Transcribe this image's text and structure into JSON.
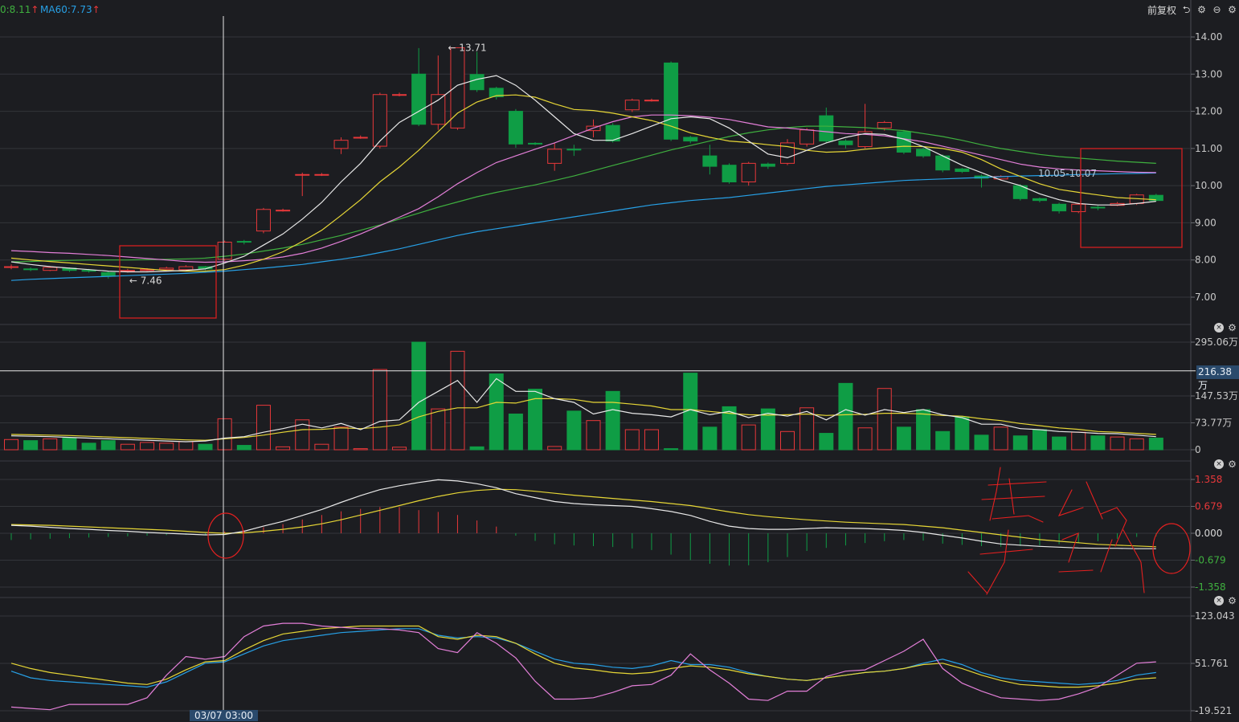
{
  "header": {
    "ma_left": "0:8.11",
    "ma_left_arrow": "↑",
    "ma60": "MA60:7.73",
    "ma60_arrow": "↑",
    "fq_label": "前复权"
  },
  "colors": {
    "bg": "#1c1d21",
    "grid": "#33353a",
    "up": "#e8383a",
    "down": "#0f9d45",
    "ma5": "#e8e8e8",
    "ma10": "#e6d636",
    "ma20": "#e37fd8",
    "ma30": "#3fb03f",
    "ma60": "#27a0e6",
    "highlight": "#d42020",
    "annot": "#e52020"
  },
  "crosshair": {
    "time_label": "03/07 03:00",
    "volume_value": "216.38万"
  },
  "chart_data": [
    {
      "type": "candlestick",
      "panel": "price",
      "ylim": [
        7.0,
        14.0
      ],
      "y_ticks": [
        "14.00",
        "13.00",
        "12.00",
        "11.00",
        "10.00",
        "9.00",
        "8.00",
        "7.00"
      ],
      "y_tick_values": [
        14,
        13,
        12,
        11,
        10,
        9,
        8,
        7
      ],
      "annotations": {
        "high_label": "13.71",
        "low_label": "7.46",
        "range_label": "10.05-10.07"
      },
      "candles": [
        [
          7.8,
          7.82,
          7.75,
          7.88
        ],
        [
          7.76,
          7.74,
          7.7,
          7.8
        ],
        [
          7.72,
          7.8,
          7.7,
          7.84
        ],
        [
          7.78,
          7.72,
          7.68,
          7.8
        ],
        [
          7.72,
          7.7,
          7.66,
          7.76
        ],
        [
          7.66,
          7.56,
          7.5,
          7.7
        ],
        [
          7.7,
          7.72,
          7.66,
          7.76
        ],
        [
          7.72,
          7.74,
          7.7,
          7.78
        ],
        [
          7.74,
          7.78,
          7.72,
          7.82
        ],
        [
          7.74,
          7.82,
          7.7,
          7.86
        ],
        [
          7.82,
          7.76,
          7.72,
          7.84
        ],
        [
          8.02,
          8.48,
          7.98,
          8.52
        ],
        [
          8.5,
          8.48,
          8.42,
          8.54
        ],
        [
          8.78,
          9.36,
          8.72,
          9.4
        ],
        [
          9.34,
          9.34,
          9.3,
          9.38
        ],
        [
          10.3,
          10.3,
          9.72,
          10.35
        ],
        [
          10.3,
          10.3,
          10.26,
          10.34
        ],
        [
          11.0,
          11.22,
          10.85,
          11.3
        ],
        [
          11.3,
          11.3,
          11.26,
          11.35
        ],
        [
          11.06,
          12.45,
          11.0,
          12.5
        ],
        [
          12.45,
          12.45,
          12.4,
          12.5
        ],
        [
          13.0,
          11.65,
          11.6,
          13.7
        ],
        [
          11.65,
          12.45,
          11.5,
          13.5
        ],
        [
          11.55,
          13.71,
          11.5,
          13.71
        ],
        [
          12.99,
          12.58,
          12.52,
          13.6
        ],
        [
          12.62,
          12.39,
          12.32,
          12.66
        ],
        [
          12.0,
          11.12,
          11.02,
          12.06
        ],
        [
          11.14,
          11.13,
          11.09,
          11.17
        ],
        [
          10.6,
          10.98,
          10.4,
          11.15
        ],
        [
          10.98,
          10.96,
          10.8,
          11.1
        ],
        [
          11.48,
          11.6,
          11.3,
          11.78
        ],
        [
          11.62,
          11.2,
          11.16,
          11.68
        ],
        [
          12.04,
          12.3,
          11.98,
          12.34
        ],
        [
          12.3,
          12.3,
          12.26,
          12.34
        ],
        [
          13.3,
          11.25,
          11.2,
          13.34
        ],
        [
          11.3,
          11.2,
          11.14,
          11.34
        ],
        [
          10.8,
          10.52,
          10.3,
          11.1
        ],
        [
          10.55,
          10.1,
          10.05,
          10.6
        ],
        [
          10.1,
          10.6,
          10.0,
          10.64
        ],
        [
          10.58,
          10.52,
          10.45,
          10.62
        ],
        [
          10.6,
          11.15,
          10.55,
          11.25
        ],
        [
          11.12,
          11.5,
          11.05,
          11.55
        ],
        [
          11.88,
          11.2,
          11.15,
          12.1
        ],
        [
          11.2,
          11.1,
          11.0,
          11.25
        ],
        [
          11.05,
          11.45,
          11.0,
          12.2
        ],
        [
          11.55,
          11.7,
          11.48,
          11.74
        ],
        [
          11.45,
          10.9,
          10.85,
          11.5
        ],
        [
          10.98,
          10.8,
          10.75,
          11.02
        ],
        [
          10.8,
          10.42,
          10.36,
          10.84
        ],
        [
          10.45,
          10.38,
          10.34,
          10.48
        ],
        [
          10.26,
          10.2,
          9.95,
          10.3
        ],
        [
          10.18,
          10.25,
          10.15,
          10.28
        ],
        [
          10.0,
          9.65,
          9.6,
          10.04
        ],
        [
          9.65,
          9.6,
          9.55,
          9.68
        ],
        [
          9.5,
          9.32,
          9.25,
          9.54
        ],
        [
          9.3,
          9.5,
          9.26,
          9.54
        ],
        [
          9.42,
          9.4,
          9.34,
          9.46
        ],
        [
          9.47,
          9.52,
          9.45,
          9.56
        ],
        [
          9.52,
          9.75,
          9.48,
          9.78
        ],
        [
          9.74,
          9.6,
          9.58,
          9.78
        ]
      ],
      "ma5": [
        7.95,
        7.88,
        7.82,
        7.78,
        7.74,
        7.7,
        7.68,
        7.68,
        7.7,
        7.72,
        7.76,
        7.92,
        8.1,
        8.4,
        8.7,
        9.1,
        9.55,
        10.1,
        10.6,
        11.2,
        11.7,
        12.0,
        12.3,
        12.7,
        12.86,
        12.96,
        12.7,
        12.3,
        11.85,
        11.4,
        11.22,
        11.22,
        11.4,
        11.6,
        11.8,
        11.85,
        11.8,
        11.55,
        11.2,
        10.85,
        10.75,
        10.95,
        11.15,
        11.3,
        11.4,
        11.38,
        11.25,
        11.05,
        10.8,
        10.55,
        10.35,
        10.15,
        10.0,
        9.78,
        9.62,
        9.52,
        9.48,
        9.48,
        9.52,
        9.58
      ],
      "ma10": [
        8.05,
        8.0,
        7.96,
        7.92,
        7.88,
        7.84,
        7.8,
        7.76,
        7.72,
        7.7,
        7.7,
        7.74,
        7.86,
        8.02,
        8.22,
        8.5,
        8.8,
        9.2,
        9.62,
        10.1,
        10.5,
        10.95,
        11.45,
        11.95,
        12.25,
        12.42,
        12.44,
        12.38,
        12.2,
        12.05,
        12.02,
        11.95,
        11.85,
        11.75,
        11.6,
        11.42,
        11.3,
        11.2,
        11.16,
        11.1,
        11.05,
        10.95,
        10.9,
        10.92,
        10.98,
        11.02,
        11.06,
        11.05,
        11.0,
        10.9,
        10.7,
        10.45,
        10.25,
        10.05,
        9.9,
        9.82,
        9.75,
        9.68,
        9.65,
        9.62
      ],
      "ma20": [
        8.25,
        8.23,
        8.2,
        8.18,
        8.15,
        8.12,
        8.08,
        8.04,
        8.0,
        7.96,
        7.94,
        7.95,
        7.98,
        8.02,
        8.08,
        8.18,
        8.32,
        8.5,
        8.7,
        8.92,
        9.15,
        9.38,
        9.7,
        10.05,
        10.35,
        10.62,
        10.8,
        10.98,
        11.15,
        11.35,
        11.55,
        11.72,
        11.85,
        11.9,
        11.9,
        11.88,
        11.84,
        11.78,
        11.68,
        11.58,
        11.55,
        11.5,
        11.45,
        11.4,
        11.38,
        11.34,
        11.26,
        11.18,
        11.06,
        10.94,
        10.82,
        10.7,
        10.58,
        10.5,
        10.45,
        10.42,
        10.4,
        10.38,
        10.36,
        10.35
      ],
      "ma30": [
        7.95,
        7.96,
        7.98,
        7.99,
        8.0,
        8.0,
        8.0,
        8.01,
        8.02,
        8.03,
        8.05,
        8.1,
        8.16,
        8.24,
        8.32,
        8.42,
        8.54,
        8.66,
        8.8,
        8.94,
        9.1,
        9.26,
        9.42,
        9.56,
        9.7,
        9.82,
        9.92,
        10.02,
        10.14,
        10.26,
        10.4,
        10.54,
        10.68,
        10.82,
        10.96,
        11.08,
        11.2,
        11.32,
        11.42,
        11.5,
        11.56,
        11.6,
        11.6,
        11.58,
        11.56,
        11.52,
        11.48,
        11.4,
        11.32,
        11.22,
        11.1,
        11.0,
        10.92,
        10.84,
        10.78,
        10.74,
        10.7,
        10.66,
        10.63,
        10.6
      ],
      "ma60": [
        7.45,
        7.48,
        7.5,
        7.52,
        7.54,
        7.56,
        7.58,
        7.6,
        7.62,
        7.64,
        7.67,
        7.7,
        7.74,
        7.78,
        7.83,
        7.88,
        7.95,
        8.02,
        8.1,
        8.2,
        8.3,
        8.42,
        8.54,
        8.66,
        8.76,
        8.84,
        8.92,
        9.0,
        9.08,
        9.16,
        9.24,
        9.32,
        9.4,
        9.48,
        9.54,
        9.6,
        9.64,
        9.68,
        9.74,
        9.8,
        9.86,
        9.92,
        9.98,
        10.02,
        10.06,
        10.1,
        10.14,
        10.16,
        10.18,
        10.2,
        10.22,
        10.24,
        10.26,
        10.27,
        10.28,
        10.3,
        10.31,
        10.32,
        10.33,
        10.34
      ]
    },
    {
      "type": "bar",
      "panel": "volume",
      "unit": "万",
      "ylim": [
        0,
        295.06
      ],
      "y_ticks": [
        "295.06万",
        "147.53万",
        "73.77万",
        "0"
      ],
      "y_tick_values": [
        295.06,
        147.53,
        73.77,
        0
      ],
      "values": [
        28,
        25,
        30,
        32,
        18,
        25,
        15,
        20,
        18,
        22,
        15,
        85,
        12,
        122,
        8,
        82,
        15,
        62,
        3,
        220,
        7,
        295,
        112,
        270,
        8,
        208,
        98,
        166,
        9,
        106,
        80,
        160,
        55,
        55,
        3,
        210,
        62,
        118,
        68,
        112,
        50,
        115,
        45,
        182,
        60,
        168,
        62,
        110,
        50,
        90,
        40,
        62,
        38,
        55,
        35,
        48,
        38,
        35,
        30,
        32
      ],
      "ma5": [
        38,
        37,
        36,
        34,
        32,
        30,
        28,
        26,
        24,
        22,
        24,
        32,
        36,
        48,
        58,
        70,
        60,
        72,
        55,
        78,
        82,
        130,
        160,
        190,
        130,
        195,
        160,
        160,
        140,
        130,
        98,
        110,
        100,
        96,
        90,
        110,
        96,
        105,
        88,
        100,
        92,
        105,
        82,
        110,
        95,
        110,
        102,
        110,
        96,
        88,
        70,
        70,
        58,
        55,
        50,
        48,
        45,
        44,
        40,
        36
      ],
      "ma10": [
        42,
        41,
        40,
        39,
        37,
        35,
        33,
        31,
        29,
        27,
        26,
        30,
        34,
        40,
        48,
        55,
        56,
        60,
        58,
        62,
        68,
        90,
        105,
        115,
        115,
        130,
        128,
        140,
        140,
        138,
        130,
        130,
        125,
        120,
        110,
        110,
        105,
        100,
        96,
        95,
        96,
        98,
        94,
        96,
        97,
        100,
        100,
        98,
        94,
        92,
        85,
        80,
        72,
        66,
        60,
        56,
        50,
        48,
        45,
        42
      ],
      "highlight_value": 216.38
    },
    {
      "type": "macd",
      "panel": "macd",
      "ylim": [
        -1.358,
        1.358
      ],
      "y_ticks": [
        "1.358",
        "0.679",
        "0.000",
        "-0.679",
        "-1.358"
      ],
      "y_tick_values": [
        1.358,
        0.679,
        0,
        -0.679,
        -1.358
      ],
      "dif": [
        0.2,
        0.18,
        0.15,
        0.12,
        0.1,
        0.07,
        0.05,
        0.02,
        0.0,
        -0.02,
        -0.04,
        -0.03,
        0.05,
        0.18,
        0.3,
        0.45,
        0.6,
        0.78,
        0.95,
        1.1,
        1.2,
        1.28,
        1.35,
        1.32,
        1.25,
        1.15,
        1.0,
        0.9,
        0.8,
        0.75,
        0.72,
        0.7,
        0.68,
        0.62,
        0.55,
        0.45,
        0.3,
        0.18,
        0.12,
        0.1,
        0.1,
        0.12,
        0.14,
        0.13,
        0.12,
        0.1,
        0.07,
        0.02,
        -0.05,
        -0.12,
        -0.2,
        -0.27,
        -0.3,
        -0.33,
        -0.35,
        -0.37,
        -0.38,
        -0.38,
        -0.39,
        -0.39
      ],
      "dea": [
        0.22,
        0.21,
        0.2,
        0.18,
        0.16,
        0.14,
        0.12,
        0.1,
        0.08,
        0.05,
        0.02,
        0.0,
        0.01,
        0.05,
        0.1,
        0.16,
        0.24,
        0.34,
        0.46,
        0.58,
        0.7,
        0.82,
        0.93,
        1.02,
        1.08,
        1.11,
        1.1,
        1.06,
        1.01,
        0.96,
        0.92,
        0.88,
        0.84,
        0.8,
        0.75,
        0.7,
        0.62,
        0.54,
        0.47,
        0.42,
        0.38,
        0.34,
        0.31,
        0.28,
        0.26,
        0.24,
        0.22,
        0.18,
        0.14,
        0.08,
        0.02,
        -0.04,
        -0.1,
        -0.16,
        -0.2,
        -0.24,
        -0.28,
        -0.3,
        -0.32,
        -0.34
      ],
      "hist": [
        -0.22,
        -0.2,
        -0.18,
        -0.16,
        -0.14,
        -0.12,
        -0.1,
        -0.08,
        -0.06,
        -0.05,
        -0.04,
        0.06,
        0.1,
        0.2,
        0.3,
        0.45,
        0.6,
        0.72,
        0.8,
        0.86,
        0.86,
        0.76,
        0.7,
        0.6,
        0.42,
        0.22,
        -0.08,
        -0.25,
        -0.36,
        -0.4,
        -0.42,
        -0.45,
        -0.5,
        -0.55,
        -0.7,
        -0.88,
        -1.0,
        -1.06,
        -1.05,
        -0.95,
        -0.78,
        -0.58,
        -0.48,
        -0.4,
        -0.32,
        -0.26,
        -0.22,
        -0.24,
        -0.34,
        -0.38,
        -0.42,
        -0.44,
        -0.42,
        -0.4,
        -0.36,
        -0.32,
        -0.26,
        -0.18,
        -0.12,
        -0.1
      ]
    },
    {
      "type": "line",
      "panel": "kdj",
      "ylim": [
        -19.521,
        123.043
      ],
      "y_ticks": [
        "123.043",
        "51.761",
        "-19.521"
      ],
      "y_tick_values": [
        123.043,
        51.761,
        -19.521
      ],
      "k": [
        52,
        44,
        38,
        34,
        30,
        26,
        22,
        20,
        28,
        42,
        54,
        56,
        72,
        86,
        96,
        100,
        104,
        106,
        108,
        108,
        108,
        108,
        92,
        88,
        94,
        92,
        82,
        66,
        52,
        45,
        42,
        38,
        36,
        38,
        44,
        48,
        46,
        42,
        36,
        32,
        28,
        26,
        30,
        34,
        38,
        40,
        44,
        50,
        52,
        44,
        34,
        26,
        20,
        18,
        16,
        16,
        18,
        22,
        28,
        30
      ],
      "d": [
        40,
        30,
        26,
        24,
        22,
        20,
        18,
        16,
        24,
        38,
        52,
        54,
        66,
        78,
        86,
        90,
        94,
        98,
        100,
        102,
        104,
        104,
        94,
        90,
        92,
        90,
        82,
        70,
        58,
        52,
        50,
        46,
        44,
        48,
        56,
        50,
        50,
        46,
        38,
        32,
        28,
        26,
        30,
        34,
        38,
        40,
        44,
        52,
        58,
        50,
        38,
        30,
        26,
        24,
        22,
        20,
        22,
        26,
        34,
        38
      ],
      "j": [
        -14,
        -16,
        -18,
        -10,
        -10,
        -10,
        -10,
        0,
        34,
        62,
        58,
        62,
        92,
        108,
        112,
        112,
        108,
        106,
        104,
        104,
        102,
        98,
        74,
        68,
        98,
        82,
        60,
        25,
        -2,
        -2,
        0,
        8,
        18,
        20,
        34,
        66,
        42,
        22,
        -2,
        -4,
        10,
        10,
        32,
        40,
        42,
        56,
        70,
        88,
        44,
        22,
        10,
        0,
        -2,
        -4,
        -2,
        6,
        16,
        34,
        52,
        54
      ]
    }
  ]
}
